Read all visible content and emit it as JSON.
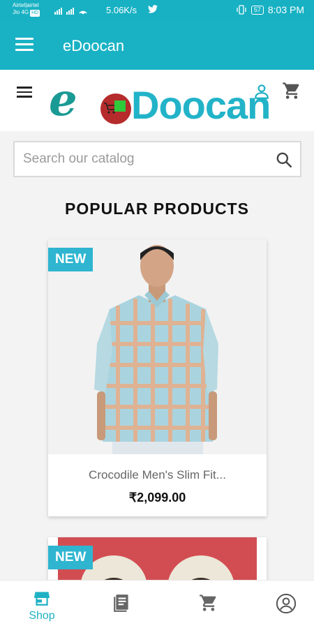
{
  "status_bar": {
    "carrier1": "Airtel|airtel",
    "carrier2": "Jio 4G",
    "hd": "HD",
    "speed": "5.06K/s",
    "battery": "57",
    "time": "8:03 PM"
  },
  "appbar": {
    "title": "eDoocan"
  },
  "logo": {
    "text": "Doocan",
    "letter": "e"
  },
  "search": {
    "placeholder": "Search our catalog"
  },
  "section": {
    "title": "POPULAR PRODUCTS"
  },
  "products": [
    {
      "badge": "NEW",
      "name": "Crocodile Men's Slim Fit...",
      "price": "₹2,099.00"
    },
    {
      "badge": "NEW"
    }
  ],
  "bottom_nav": [
    {
      "label": "Shop",
      "icon": "store-icon",
      "active": true
    },
    {
      "icon": "catalog-icon"
    },
    {
      "icon": "cart-icon"
    },
    {
      "icon": "account-icon"
    }
  ],
  "colors": {
    "accent": "#19b2c4",
    "badge": "#2fb5d0",
    "logo_red": "#b62b2b"
  }
}
